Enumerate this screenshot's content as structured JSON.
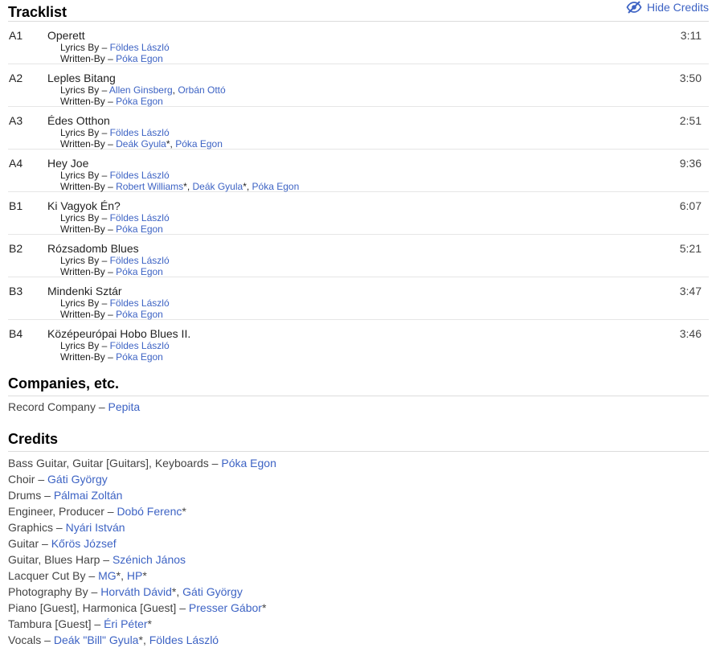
{
  "tracklist": {
    "title": "Tracklist",
    "hide_credits_label": "Hide Credits",
    "tracks": [
      {
        "position": "A1",
        "title": "Operett",
        "duration": "3:11",
        "credits": [
          {
            "role": "Lyrics By",
            "names": [
              {
                "name": "Földes László"
              }
            ]
          },
          {
            "role": "Written-By",
            "names": [
              {
                "name": "Póka Egon"
              }
            ]
          }
        ]
      },
      {
        "position": "A2",
        "title": "Leples Bitang",
        "duration": "3:50",
        "credits": [
          {
            "role": "Lyrics By",
            "names": [
              {
                "name": "Allen Ginsberg"
              },
              {
                "name": "Orbán Ottó"
              }
            ]
          },
          {
            "role": "Written-By",
            "names": [
              {
                "name": "Póka Egon"
              }
            ]
          }
        ]
      },
      {
        "position": "A3",
        "title": "Édes Otthon",
        "duration": "2:51",
        "credits": [
          {
            "role": "Lyrics By",
            "names": [
              {
                "name": "Földes László"
              }
            ]
          },
          {
            "role": "Written-By",
            "names": [
              {
                "name": "Deák Gyula",
                "star": true
              },
              {
                "name": "Póka Egon"
              }
            ]
          }
        ]
      },
      {
        "position": "A4",
        "title": "Hey Joe",
        "duration": "9:36",
        "credits": [
          {
            "role": "Lyrics By",
            "names": [
              {
                "name": "Földes László"
              }
            ]
          },
          {
            "role": "Written-By",
            "names": [
              {
                "name": "Robert Williams",
                "star": true
              },
              {
                "name": "Deák Gyula",
                "star": true
              },
              {
                "name": "Póka Egon"
              }
            ]
          }
        ]
      },
      {
        "position": "B1",
        "title": "Ki Vagyok Én?",
        "duration": "6:07",
        "credits": [
          {
            "role": "Lyrics By",
            "names": [
              {
                "name": "Földes László"
              }
            ]
          },
          {
            "role": "Written-By",
            "names": [
              {
                "name": "Póka Egon"
              }
            ]
          }
        ]
      },
      {
        "position": "B2",
        "title": "Rózsadomb Blues",
        "duration": "5:21",
        "credits": [
          {
            "role": "Lyrics By",
            "names": [
              {
                "name": "Földes László"
              }
            ]
          },
          {
            "role": "Written-By",
            "names": [
              {
                "name": "Póka Egon"
              }
            ]
          }
        ]
      },
      {
        "position": "B3",
        "title": "Mindenki Sztár",
        "duration": "3:47",
        "credits": [
          {
            "role": "Lyrics By",
            "names": [
              {
                "name": "Földes László"
              }
            ]
          },
          {
            "role": "Written-By",
            "names": [
              {
                "name": "Póka Egon"
              }
            ]
          }
        ]
      },
      {
        "position": "B4",
        "title": "Középeurópai Hobo Blues II.",
        "duration": "3:46",
        "credits": [
          {
            "role": "Lyrics By",
            "names": [
              {
                "name": "Földes László"
              }
            ]
          },
          {
            "role": "Written-By",
            "names": [
              {
                "name": "Póka Egon"
              }
            ]
          }
        ]
      }
    ]
  },
  "companies": {
    "title": "Companies, etc.",
    "items": [
      {
        "role": "Record Company",
        "names": [
          {
            "name": "Pepita"
          }
        ]
      }
    ]
  },
  "credits": {
    "title": "Credits",
    "items": [
      {
        "role": "Bass Guitar, Guitar [Guitars], Keyboards",
        "names": [
          {
            "name": "Póka Egon"
          }
        ]
      },
      {
        "role": "Choir",
        "names": [
          {
            "name": "Gáti György"
          }
        ]
      },
      {
        "role": "Drums",
        "names": [
          {
            "name": "Pálmai Zoltán"
          }
        ]
      },
      {
        "role": "Engineer, Producer",
        "names": [
          {
            "name": "Dobó Ferenc",
            "star": true
          }
        ]
      },
      {
        "role": "Graphics",
        "names": [
          {
            "name": "Nyári István"
          }
        ]
      },
      {
        "role": "Guitar",
        "names": [
          {
            "name": "Kőrös József"
          }
        ]
      },
      {
        "role": "Guitar, Blues Harp",
        "names": [
          {
            "name": "Szénich János"
          }
        ]
      },
      {
        "role": "Lacquer Cut By",
        "names": [
          {
            "name": "MG",
            "star": true
          },
          {
            "name": "HP",
            "star": true
          }
        ]
      },
      {
        "role": "Photography By",
        "names": [
          {
            "name": "Horváth Dávid",
            "star": true
          },
          {
            "name": "Gáti György"
          }
        ]
      },
      {
        "role": "Piano [Guest], Harmonica [Guest]",
        "names": [
          {
            "name": "Presser Gábor",
            "star": true
          }
        ]
      },
      {
        "role": "Tambura [Guest]",
        "names": [
          {
            "name": "Éri Péter",
            "star": true
          }
        ]
      },
      {
        "role": "Vocals",
        "names": [
          {
            "name": "Deák \"Bill\" Gyula",
            "star": true
          },
          {
            "name": "Földes László"
          }
        ]
      }
    ]
  },
  "separator": " – ",
  "star_mark": "*",
  "name_separator": ", ",
  "colors": {
    "link": "#3d63c4",
    "divider": "#dcdcdc"
  },
  "icons": {
    "hide_credits": "eye-slash-icon"
  }
}
